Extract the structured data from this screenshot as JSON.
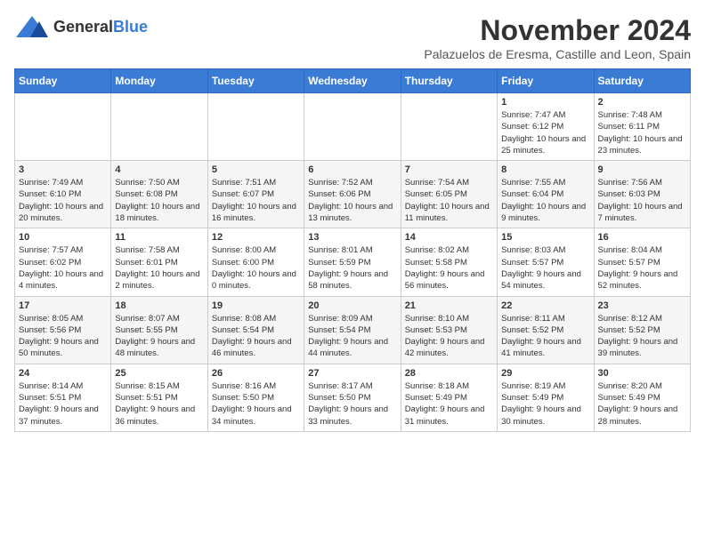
{
  "header": {
    "logo_general": "General",
    "logo_blue": "Blue",
    "month_title": "November 2024",
    "subtitle": "Palazuelos de Eresma, Castille and Leon, Spain"
  },
  "days_of_week": [
    "Sunday",
    "Monday",
    "Tuesday",
    "Wednesday",
    "Thursday",
    "Friday",
    "Saturday"
  ],
  "weeks": [
    [
      {
        "day": "",
        "info": ""
      },
      {
        "day": "",
        "info": ""
      },
      {
        "day": "",
        "info": ""
      },
      {
        "day": "",
        "info": ""
      },
      {
        "day": "",
        "info": ""
      },
      {
        "day": "1",
        "info": "Sunrise: 7:47 AM\nSunset: 6:12 PM\nDaylight: 10 hours and 25 minutes."
      },
      {
        "day": "2",
        "info": "Sunrise: 7:48 AM\nSunset: 6:11 PM\nDaylight: 10 hours and 23 minutes."
      }
    ],
    [
      {
        "day": "3",
        "info": "Sunrise: 7:49 AM\nSunset: 6:10 PM\nDaylight: 10 hours and 20 minutes."
      },
      {
        "day": "4",
        "info": "Sunrise: 7:50 AM\nSunset: 6:08 PM\nDaylight: 10 hours and 18 minutes."
      },
      {
        "day": "5",
        "info": "Sunrise: 7:51 AM\nSunset: 6:07 PM\nDaylight: 10 hours and 16 minutes."
      },
      {
        "day": "6",
        "info": "Sunrise: 7:52 AM\nSunset: 6:06 PM\nDaylight: 10 hours and 13 minutes."
      },
      {
        "day": "7",
        "info": "Sunrise: 7:54 AM\nSunset: 6:05 PM\nDaylight: 10 hours and 11 minutes."
      },
      {
        "day": "8",
        "info": "Sunrise: 7:55 AM\nSunset: 6:04 PM\nDaylight: 10 hours and 9 minutes."
      },
      {
        "day": "9",
        "info": "Sunrise: 7:56 AM\nSunset: 6:03 PM\nDaylight: 10 hours and 7 minutes."
      }
    ],
    [
      {
        "day": "10",
        "info": "Sunrise: 7:57 AM\nSunset: 6:02 PM\nDaylight: 10 hours and 4 minutes."
      },
      {
        "day": "11",
        "info": "Sunrise: 7:58 AM\nSunset: 6:01 PM\nDaylight: 10 hours and 2 minutes."
      },
      {
        "day": "12",
        "info": "Sunrise: 8:00 AM\nSunset: 6:00 PM\nDaylight: 10 hours and 0 minutes."
      },
      {
        "day": "13",
        "info": "Sunrise: 8:01 AM\nSunset: 5:59 PM\nDaylight: 9 hours and 58 minutes."
      },
      {
        "day": "14",
        "info": "Sunrise: 8:02 AM\nSunset: 5:58 PM\nDaylight: 9 hours and 56 minutes."
      },
      {
        "day": "15",
        "info": "Sunrise: 8:03 AM\nSunset: 5:57 PM\nDaylight: 9 hours and 54 minutes."
      },
      {
        "day": "16",
        "info": "Sunrise: 8:04 AM\nSunset: 5:57 PM\nDaylight: 9 hours and 52 minutes."
      }
    ],
    [
      {
        "day": "17",
        "info": "Sunrise: 8:05 AM\nSunset: 5:56 PM\nDaylight: 9 hours and 50 minutes."
      },
      {
        "day": "18",
        "info": "Sunrise: 8:07 AM\nSunset: 5:55 PM\nDaylight: 9 hours and 48 minutes."
      },
      {
        "day": "19",
        "info": "Sunrise: 8:08 AM\nSunset: 5:54 PM\nDaylight: 9 hours and 46 minutes."
      },
      {
        "day": "20",
        "info": "Sunrise: 8:09 AM\nSunset: 5:54 PM\nDaylight: 9 hours and 44 minutes."
      },
      {
        "day": "21",
        "info": "Sunrise: 8:10 AM\nSunset: 5:53 PM\nDaylight: 9 hours and 42 minutes."
      },
      {
        "day": "22",
        "info": "Sunrise: 8:11 AM\nSunset: 5:52 PM\nDaylight: 9 hours and 41 minutes."
      },
      {
        "day": "23",
        "info": "Sunrise: 8:12 AM\nSunset: 5:52 PM\nDaylight: 9 hours and 39 minutes."
      }
    ],
    [
      {
        "day": "24",
        "info": "Sunrise: 8:14 AM\nSunset: 5:51 PM\nDaylight: 9 hours and 37 minutes."
      },
      {
        "day": "25",
        "info": "Sunrise: 8:15 AM\nSunset: 5:51 PM\nDaylight: 9 hours and 36 minutes."
      },
      {
        "day": "26",
        "info": "Sunrise: 8:16 AM\nSunset: 5:50 PM\nDaylight: 9 hours and 34 minutes."
      },
      {
        "day": "27",
        "info": "Sunrise: 8:17 AM\nSunset: 5:50 PM\nDaylight: 9 hours and 33 minutes."
      },
      {
        "day": "28",
        "info": "Sunrise: 8:18 AM\nSunset: 5:49 PM\nDaylight: 9 hours and 31 minutes."
      },
      {
        "day": "29",
        "info": "Sunrise: 8:19 AM\nSunset: 5:49 PM\nDaylight: 9 hours and 30 minutes."
      },
      {
        "day": "30",
        "info": "Sunrise: 8:20 AM\nSunset: 5:49 PM\nDaylight: 9 hours and 28 minutes."
      }
    ]
  ]
}
